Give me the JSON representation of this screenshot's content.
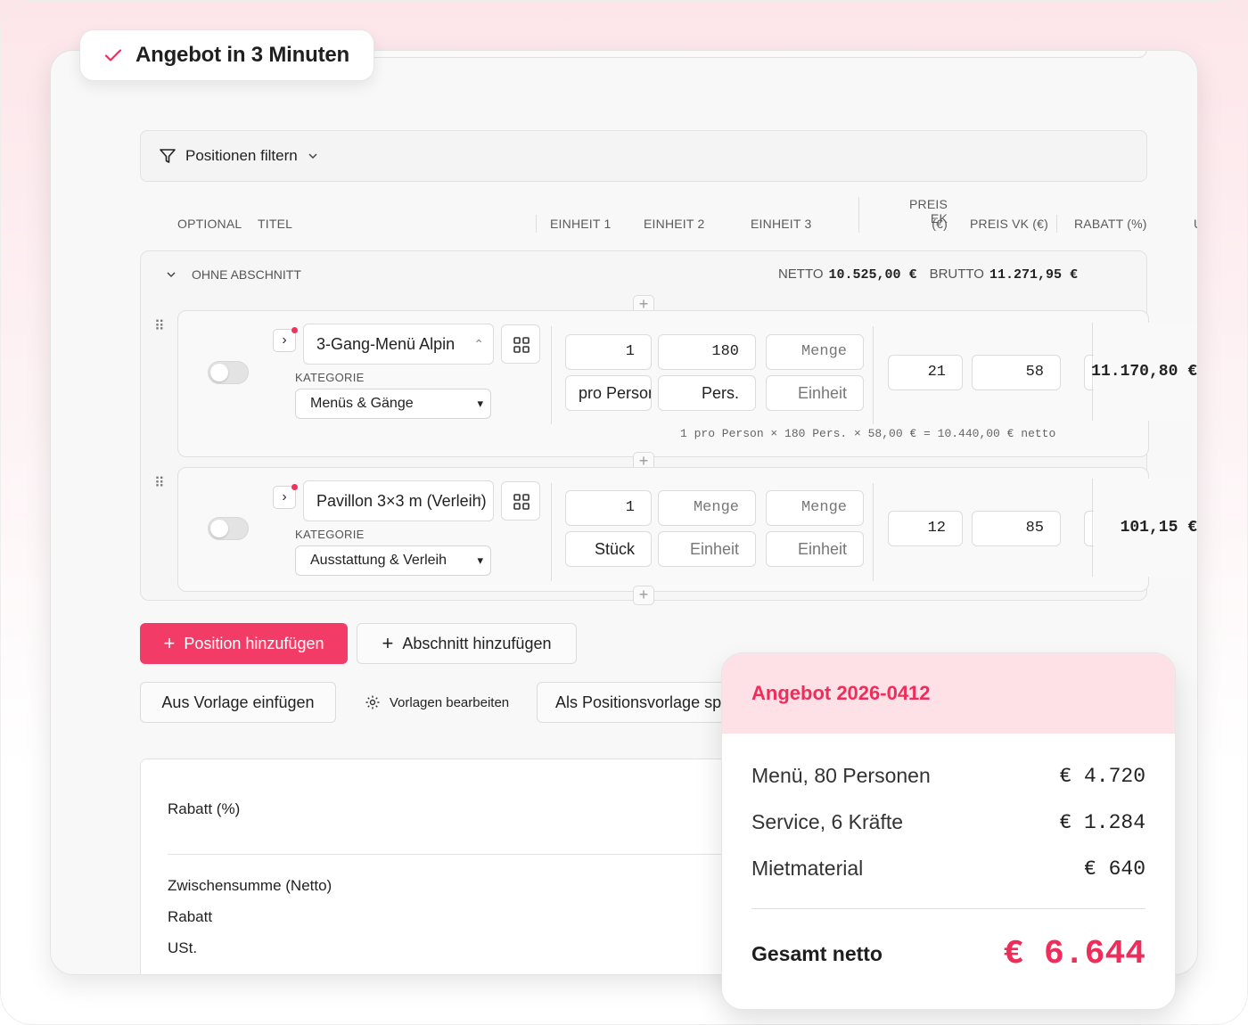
{
  "badge": {
    "text": "Angebot in 3 Minuten"
  },
  "filter": {
    "label": "Positionen filtern"
  },
  "columns": {
    "optional": "OPTIONAL",
    "titel": "TITEL",
    "einheit1": "EINHEIT 1",
    "einheit2": "EINHEIT 2",
    "einheit3": "EINHEIT 3",
    "preis_ek_1": "PREIS EK",
    "preis_ek_2": "(€)",
    "preis_vk": "PREIS VK (€)",
    "rabatt": "RABATT (%)",
    "cut": "U"
  },
  "section": {
    "name": "OHNE ABSCHNITT",
    "netto_label": "NETTO",
    "netto_value": "10.525,00 €",
    "brutto_label": "BRUTTO",
    "brutto_value": "11.271,95 €"
  },
  "positions": [
    {
      "title": "3-Gang-Menü Alpin",
      "kategorie_label": "KATEGORIE",
      "kategorie": "Menüs & Gänge",
      "qty1": "1",
      "qty2": "180",
      "qty3_ph": "Menge",
      "unit1": "pro Person",
      "unit2": "Pers.",
      "unit3_ph": "Einheit",
      "ek": "21",
      "vk": "58",
      "total": "11.170,80 €",
      "calc": "1 pro Person × 180 Pers. × 58,00 € = 10.440,00 € netto"
    },
    {
      "title": "Pavillon 3×3 m (Verleih)",
      "kategorie_label": "KATEGORIE",
      "kategorie": "Ausstattung & Verleih",
      "qty1": "1",
      "qty2_ph": "Menge",
      "qty3_ph": "Menge",
      "unit1": "Stück",
      "unit2_ph": "Einheit",
      "unit3_ph": "Einheit",
      "ek": "12",
      "vk": "85",
      "total": "101,15 €"
    }
  ],
  "buttons": {
    "add_position": "Position hinzufügen",
    "add_section": "Abschnitt hinzufügen",
    "from_template": "Aus Vorlage einfügen",
    "edit_templates": "Vorlagen bearbeiten",
    "save_template": "Als Positionsvorlage speichern"
  },
  "summary": {
    "rabatt": "Rabatt (%)",
    "zwischensumme": "Zwischensumme (Netto)",
    "rabatt2": "Rabatt",
    "ust": "USt."
  },
  "card": {
    "title": "Angebot 2026-0412",
    "lines": [
      {
        "label": "Menü, 80 Personen",
        "value": "€ 4.720"
      },
      {
        "label": "Service, 6 Kräfte",
        "value": "€ 1.284"
      },
      {
        "label": "Mietmaterial",
        "value": "€ 640"
      }
    ],
    "total_label": "Gesamt netto",
    "total_value": "€ 6.644"
  },
  "colors": {
    "accent": "#f23c67",
    "accent_soft": "#fde1e7"
  }
}
